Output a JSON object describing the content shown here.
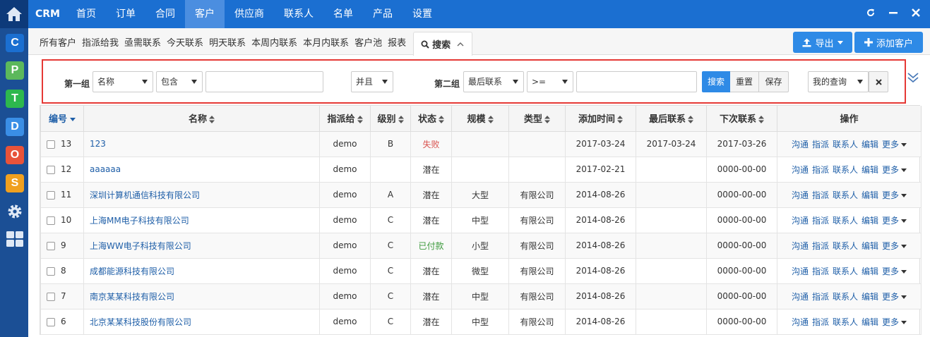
{
  "topbar": {
    "brand": "CRM",
    "nav": [
      {
        "label": "首页",
        "active": false
      },
      {
        "label": "订单",
        "active": false
      },
      {
        "label": "合同",
        "active": false
      },
      {
        "label": "客户",
        "active": true
      },
      {
        "label": "供应商",
        "active": false
      },
      {
        "label": "联系人",
        "active": false
      },
      {
        "label": "名单",
        "active": false
      },
      {
        "label": "产品",
        "active": false
      },
      {
        "label": "设置",
        "active": false
      }
    ]
  },
  "leftbar": {
    "apps": [
      {
        "letter": "C",
        "color": "#1b6fd1"
      },
      {
        "letter": "P",
        "color": "#5cb85c"
      },
      {
        "letter": "T",
        "color": "#2db84d"
      },
      {
        "letter": "D",
        "color": "#3a8ee6"
      },
      {
        "letter": "O",
        "color": "#e8533a"
      },
      {
        "letter": "S",
        "color": "#f0a020"
      }
    ]
  },
  "subnav": {
    "tabs": [
      "所有客户",
      "指派给我",
      "亟需联系",
      "今天联系",
      "明天联系",
      "本周内联系",
      "本月内联系",
      "客户池",
      "报表"
    ],
    "search_tab": "搜索"
  },
  "actions": {
    "export": "导出",
    "add": "添加客户"
  },
  "search": {
    "group1_label": "第一组",
    "group1_field": "名称",
    "group1_op": "包含",
    "group1_value": "",
    "logic": "并且",
    "group2_label": "第二组",
    "group2_field": "最后联系",
    "group2_op": ">=",
    "group2_value": "",
    "search_btn": "搜索",
    "reset_btn": "重置",
    "save_btn": "保存",
    "my_query": "我的查询"
  },
  "table": {
    "columns": [
      "编号",
      "名称",
      "指派给",
      "级别",
      "状态",
      "规模",
      "类型",
      "添加时间",
      "最后联系",
      "下次联系",
      "操作"
    ],
    "rows": [
      {
        "id": "13",
        "name": "123",
        "assignee": "demo",
        "level": "B",
        "status": "失败",
        "status_color": "#d9534f",
        "scale": "",
        "type": "",
        "added": "2017-03-24",
        "last": "2017-03-24",
        "next": "2017-03-26"
      },
      {
        "id": "12",
        "name": "aaaaaa",
        "assignee": "demo",
        "level": "",
        "status": "潜在",
        "status_color": "#333333",
        "scale": "",
        "type": "",
        "added": "2017-02-21",
        "last": "",
        "next": "0000-00-00"
      },
      {
        "id": "11",
        "name": "深圳计算机通信科技有限公司",
        "assignee": "demo",
        "level": "A",
        "status": "潜在",
        "status_color": "#333333",
        "scale": "大型",
        "type": "有限公司",
        "added": "2014-08-26",
        "last": "",
        "next": "0000-00-00"
      },
      {
        "id": "10",
        "name": "上海MM电子科技有限公司",
        "assignee": "demo",
        "level": "C",
        "status": "潜在",
        "status_color": "#333333",
        "scale": "中型",
        "type": "有限公司",
        "added": "2014-08-26",
        "last": "",
        "next": "0000-00-00"
      },
      {
        "id": "9",
        "name": "上海WW电子科技有限公司",
        "assignee": "demo",
        "level": "C",
        "status": "已付款",
        "status_color": "#3c9a3c",
        "scale": "小型",
        "type": "有限公司",
        "added": "2014-08-26",
        "last": "",
        "next": "0000-00-00"
      },
      {
        "id": "8",
        "name": "成都能源科技有限公司",
        "assignee": "demo",
        "level": "C",
        "status": "潜在",
        "status_color": "#333333",
        "scale": "微型",
        "type": "有限公司",
        "added": "2014-08-26",
        "last": "",
        "next": "0000-00-00"
      },
      {
        "id": "7",
        "name": "南京某某科技有限公司",
        "assignee": "demo",
        "level": "C",
        "status": "潜在",
        "status_color": "#333333",
        "scale": "中型",
        "type": "有限公司",
        "added": "2014-08-26",
        "last": "",
        "next": "0000-00-00"
      },
      {
        "id": "6",
        "name": "北京某某科技股份有限公司",
        "assignee": "demo",
        "level": "C",
        "status": "潜在",
        "status_color": "#333333",
        "scale": "中型",
        "type": "有限公司",
        "added": "2014-08-26",
        "last": "",
        "next": "0000-00-00"
      }
    ],
    "row_actions": [
      "沟通",
      "指派",
      "联系人",
      "编辑",
      "更多"
    ]
  }
}
